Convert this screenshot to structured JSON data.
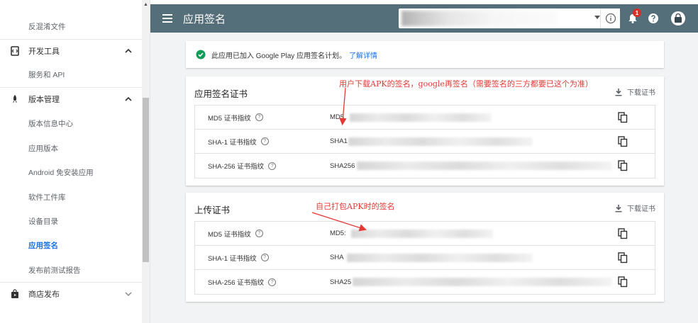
{
  "sidebar": {
    "items": [
      {
        "label": "反混淆文件"
      },
      {
        "label": "开发工具"
      },
      {
        "label": "服务和 API"
      },
      {
        "label": "版本管理"
      },
      {
        "label": "版本信息中心"
      },
      {
        "label": "应用版本"
      },
      {
        "label": "Android 免安装应用"
      },
      {
        "label": "软件工件库"
      },
      {
        "label": "设备目录"
      },
      {
        "label": "应用签名"
      },
      {
        "label": "发布前测试报告"
      },
      {
        "label": "商店发布"
      }
    ]
  },
  "header": {
    "title": "应用签名",
    "notification_count": "1",
    "colors": {
      "bar": "#546e7a"
    }
  },
  "banner": {
    "text": "此应用已加入 Google Play 应用签名计划。",
    "link": "了解详情"
  },
  "app_signing_cert": {
    "title": "应用签名证书",
    "download": "下载证书",
    "rows": [
      {
        "label": "MD5 证书指纹",
        "value": "MD5"
      },
      {
        "label": "SHA-1 证书指纹",
        "value": "SHA1"
      },
      {
        "label": "SHA-256 证书指纹",
        "value": "SHA256"
      }
    ]
  },
  "upload_cert": {
    "title": "上传证书",
    "download": "下载证书",
    "rows": [
      {
        "label": "MD5 证书指纹",
        "value": "MD5:"
      },
      {
        "label": "SHA-1 证书指纹",
        "value": "SHA"
      },
      {
        "label": "SHA-256 证书指纹",
        "value": "SHA25"
      }
    ]
  },
  "annotations": {
    "top": "用户下载APK的签名，google再签名（需要签名的三方都要已这个为准）",
    "bottom": "自己打包APK时的签名",
    "color": "#e53935"
  },
  "icons": {
    "menu": "menu-icon",
    "info": "info-icon",
    "bell": "bell-icon",
    "help": "help-icon",
    "avatar": "avatar-icon",
    "download": "download-icon",
    "copy": "copy-icon",
    "check": "check-circle-icon"
  }
}
